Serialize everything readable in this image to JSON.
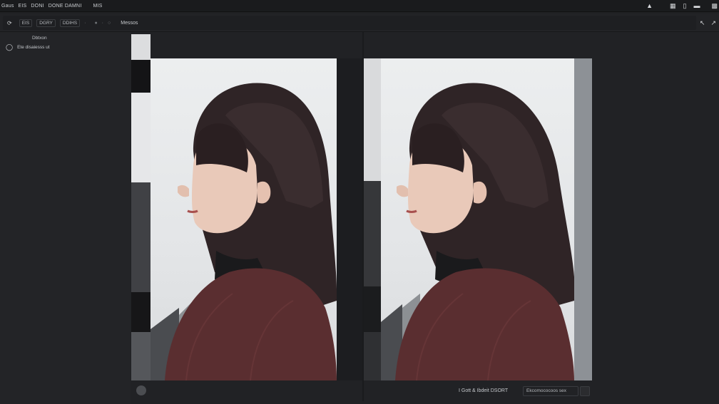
{
  "menubar": {
    "items": [
      "Gaus",
      "EIS",
      "DONI",
      "DONE DAMNI",
      "MIS"
    ],
    "right_icons": [
      "pin-icon",
      "window-icon",
      "split-icon",
      "toggle-icon",
      "restore-icon"
    ]
  },
  "toolbar": {
    "items": [
      "EIS",
      "DGRY",
      "DDIHS"
    ],
    "label": "Messos"
  },
  "left_panel": {
    "title": "Dbtxon",
    "row_label": "Ete disaiesss ut"
  },
  "status": {
    "text": "I Gott & Ibdeit DSORT",
    "field_value": "Ekcomococoos sex"
  },
  "colors": {
    "background": "#202124",
    "menubar": "#1a1b1d",
    "panel": "#232427",
    "sweater": "#5a2e30",
    "hair": "#2f2426"
  }
}
